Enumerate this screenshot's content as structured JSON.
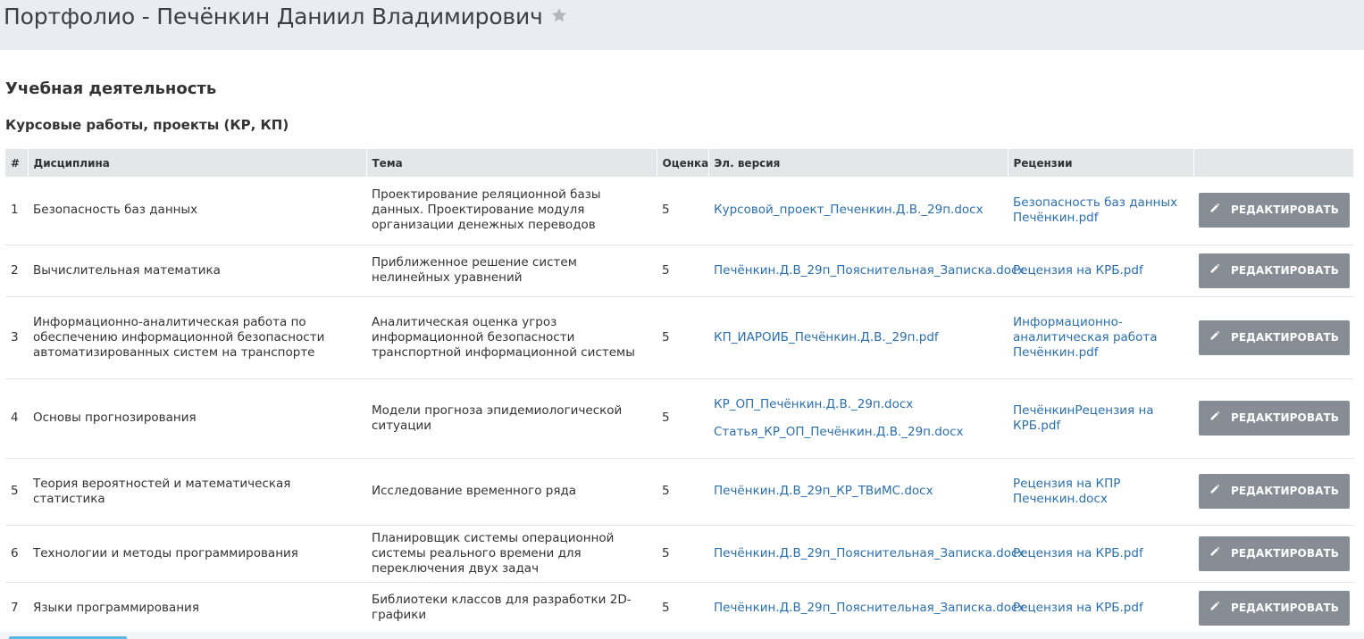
{
  "header": {
    "title": "Портфолио - Печёнкин Даниил Владимирович",
    "star_icon": "star-icon"
  },
  "section": {
    "title": "Учебная деятельность",
    "subtitle": "Курсовые работы, проекты (КР, КП)"
  },
  "table": {
    "columns": [
      "#",
      "Дисциплина",
      "Тема",
      "Оценка",
      "Эл. версия",
      "Рецензии",
      ""
    ],
    "edit_label": "РЕДАКТИРОВАТЬ",
    "edit_icon": "pencil-icon",
    "rows": [
      {
        "num": "1",
        "discipline": "Безопасность баз данных",
        "topic": "Проектирование реляционной базы данных. Проектирование модуля организации денежных переводов",
        "grade": "5",
        "files": [
          "Курсовой_проект_Печенкин.Д.В._29п.docx"
        ],
        "review": "Безопасность баз данных Печёнкин.pdf"
      },
      {
        "num": "2",
        "discipline": "Вычислительная математика",
        "topic": "Приближенное решение систем нелинейных уравнений",
        "grade": "5",
        "files": [
          "Печёнкин.Д.В_29п_Пояснительная_Записка.docx"
        ],
        "review": "Рецензия на КРБ.pdf"
      },
      {
        "num": "3",
        "discipline": "Информационно-аналитическая работа по обеспечению информационной безопасности автоматизированных систем на транспорте",
        "topic": "Аналитическая оценка угроз информационной безопасности транспортной информационной системы",
        "grade": "5",
        "files": [
          "КП_ИАРОИБ_Печёнкин.Д.В._29п.pdf"
        ],
        "review": "Информационно-аналитическая работа Печёнкин.pdf"
      },
      {
        "num": "4",
        "discipline": "Основы прогнозирования",
        "topic": "Модели прогноза эпидемиологической ситуации",
        "grade": "5",
        "files": [
          "КР_ОП_Печёнкин.Д.В._29п.docx",
          "Статья_КР_ОП_Печёнкин.Д.В._29п.docx"
        ],
        "review": "ПечёнкинРецензия на КРБ.pdf"
      },
      {
        "num": "5",
        "discipline": "Теория вероятностей и математическая статистика",
        "topic": "Исследование временного ряда",
        "grade": "5",
        "files": [
          "Печёнкин.Д.В_29п_КР_ТВиМС.docx"
        ],
        "review": "Рецензия на КПР Печенкин.docx"
      },
      {
        "num": "6",
        "discipline": "Технологии и методы программирования",
        "topic": "Планировщик системы операционной системы реального времени для переключения двух задач",
        "grade": "5",
        "files": [
          "Печёнкин.Д.В_29п_Пояснительная_Записка.docx"
        ],
        "review": "Рецензия на КРБ.pdf"
      },
      {
        "num": "7",
        "discipline": "Языки программирования",
        "topic": "Библиотеки классов для разработки 2D-графики",
        "grade": "5",
        "files": [
          "Печёнкин.Д.В_29п_Пояснительная_Записка.docx"
        ],
        "review": "Рецензия на КРБ.pdf"
      }
    ]
  },
  "colors": {
    "header_bg": "#e9edf1",
    "link": "#2a6fb0",
    "button_bg": "#868d94",
    "table_head_bg": "#e5e6e7"
  }
}
